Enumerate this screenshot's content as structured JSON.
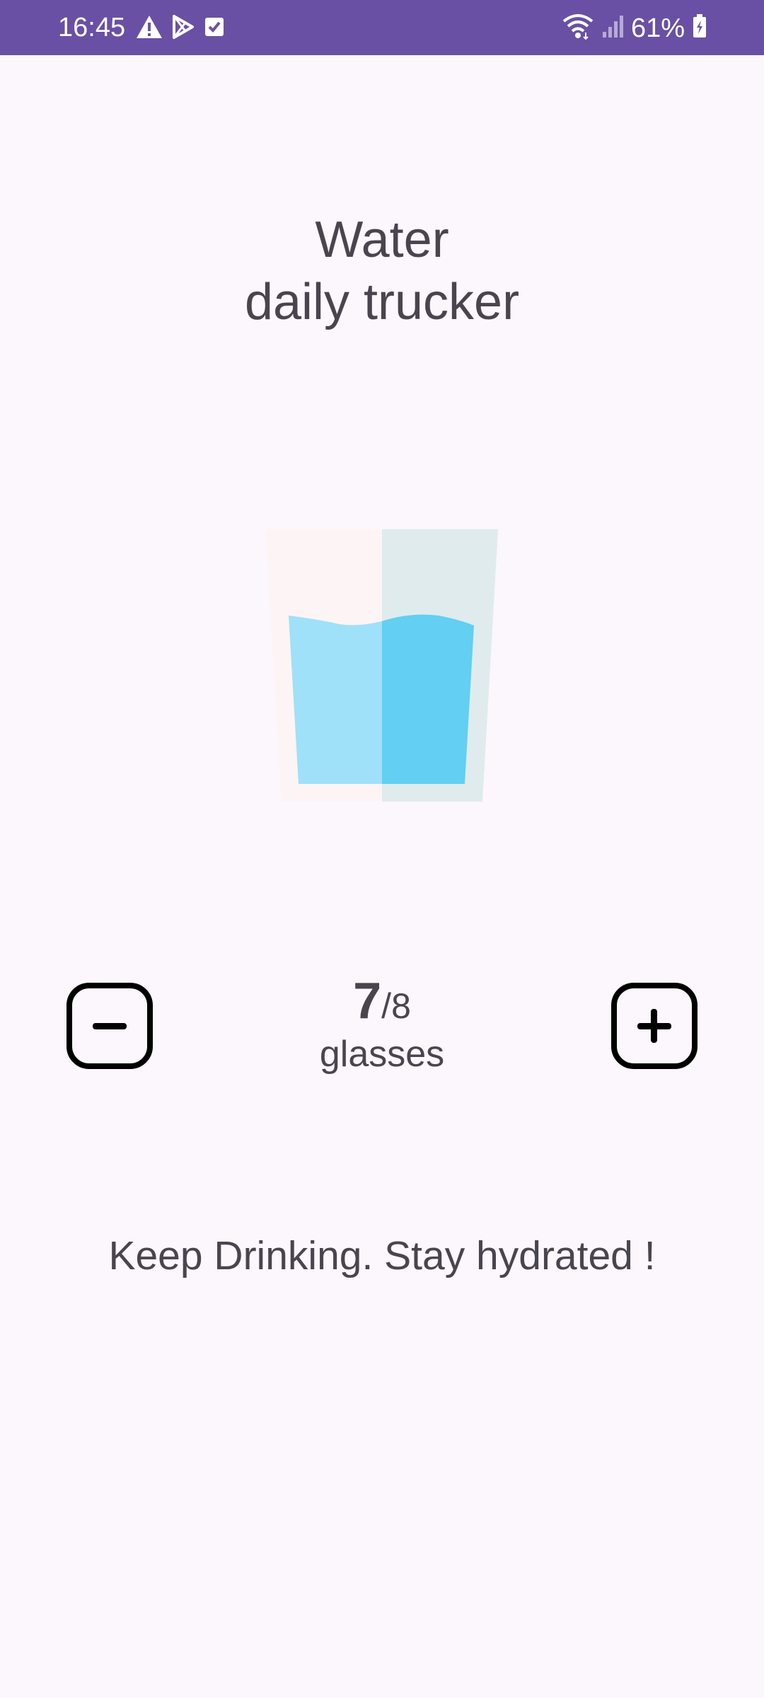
{
  "status_bar": {
    "time": "16:45",
    "battery": "61%",
    "icons": [
      "warning-icon",
      "play-store-icon",
      "checkbox-icon",
      "wifi-icon",
      "signal-icon",
      "battery-icon"
    ],
    "background": "#6a50a4"
  },
  "header": {
    "title_line1": "Water",
    "title_line2": "daily trucker"
  },
  "tracker": {
    "current": "7",
    "separator": "/",
    "goal": "8",
    "unit": "glasses",
    "fill_fraction": 0.875
  },
  "controls": {
    "decrement_icon": "minus-square-icon",
    "increment_icon": "plus-square-icon"
  },
  "message": "Keep Drinking. Stay hydrated !",
  "colors": {
    "background": "#fcf6fd",
    "text": "#48454e",
    "water_light": "#9fe1f8",
    "water_dark": "#62cff3",
    "glass_light": "#fdf4f6",
    "glass_dark": "#e0ebee"
  }
}
